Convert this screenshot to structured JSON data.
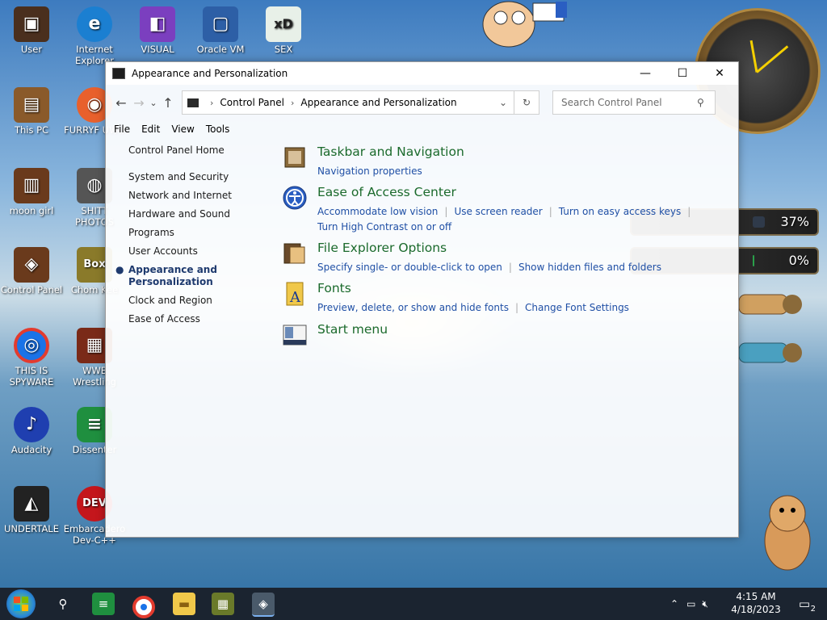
{
  "desktop": {
    "icons": [
      {
        "label": "User",
        "color": "#4a2f1e",
        "glyph": "▣"
      },
      {
        "label": "Internet Explorer",
        "color": "#1b7fd1",
        "glyph": "e"
      },
      {
        "label": "VISUAL",
        "color": "#7b3fbf",
        "glyph": "◧"
      },
      {
        "label": "Oracle VM",
        "color": "#2d5fa6",
        "glyph": "▢"
      },
      {
        "label": "SEX",
        "color": "#e8f0e8",
        "glyph": "xD"
      },
      {
        "label": "This PC",
        "color": "#8a5a2a",
        "glyph": "▤"
      },
      {
        "label": "FURRYF UWU",
        "color": "#e8602c",
        "glyph": "◉"
      },
      {
        "label": "moon girl",
        "color": "#6a3a1c",
        "glyph": "▥"
      },
      {
        "label": "SHITT PHOTOS",
        "color": "#555555",
        "glyph": "◍"
      },
      {
        "label": "Control Panel",
        "color": "#6a3a1c",
        "glyph": "◈"
      },
      {
        "label": "Chom Kee",
        "color": "#8a7a2a",
        "glyph": "Box"
      },
      {
        "label": "THIS IS SPYWARE",
        "color": "#1a73e8",
        "glyph": "◎"
      },
      {
        "label": "WWE Wrestling",
        "color": "#7a2a18",
        "glyph": "▦"
      },
      {
        "label": "Audacity",
        "color": "#1f3fb0",
        "glyph": "♪"
      },
      {
        "label": "Dissenter",
        "color": "#1f8f3f",
        "glyph": "≡"
      },
      {
        "label": "UNDERTALE",
        "color": "#222222",
        "glyph": "◭"
      },
      {
        "label": "Embarcadero Dev-C++",
        "color": "#c4161c",
        "glyph": "DEV"
      }
    ],
    "gadgets": {
      "meter1_text": "37%",
      "meter1_value": 0.37,
      "meter2_text": "0%",
      "meter2_value": 0.0
    }
  },
  "window": {
    "title": "Appearance and Personalization",
    "buttons": {
      "minimize": "—",
      "maximize": "☐",
      "close": "✕"
    },
    "nav": {
      "back": "←",
      "forward": "→",
      "recent": "⌄",
      "up": "↑",
      "refresh": "↻"
    },
    "breadcrumb": [
      "Control Panel",
      "Appearance and Personalization"
    ],
    "breadcrumb_sep": "›",
    "search_placeholder": "Search Control Panel",
    "menu": [
      "File",
      "Edit",
      "View",
      "Tools"
    ],
    "leftnav": {
      "home": "Control Panel Home",
      "items": [
        "System and Security",
        "Network and Internet",
        "Hardware and Sound",
        "Programs",
        "User Accounts"
      ],
      "current": "Appearance and Personalization",
      "after": [
        "Clock and Region",
        "Ease of Access"
      ]
    },
    "sections": [
      {
        "title": "Taskbar and Navigation",
        "links": [
          "Navigation properties"
        ]
      },
      {
        "title": "Ease of Access Center",
        "links": [
          "Accommodate low vision",
          "Use screen reader",
          "Turn on easy access keys",
          "Turn High Contrast on or off"
        ]
      },
      {
        "title": "File Explorer Options",
        "links": [
          "Specify single- or double-click to open",
          "Show hidden files and folders"
        ]
      },
      {
        "title": "Fonts",
        "links": [
          "Preview, delete, or show and hide fonts",
          "Change Font Settings"
        ]
      },
      {
        "title": "Start menu",
        "links": []
      }
    ]
  },
  "taskbar": {
    "time": "4:15 AM",
    "date": "4/18/2023",
    "notification_count": "2"
  }
}
